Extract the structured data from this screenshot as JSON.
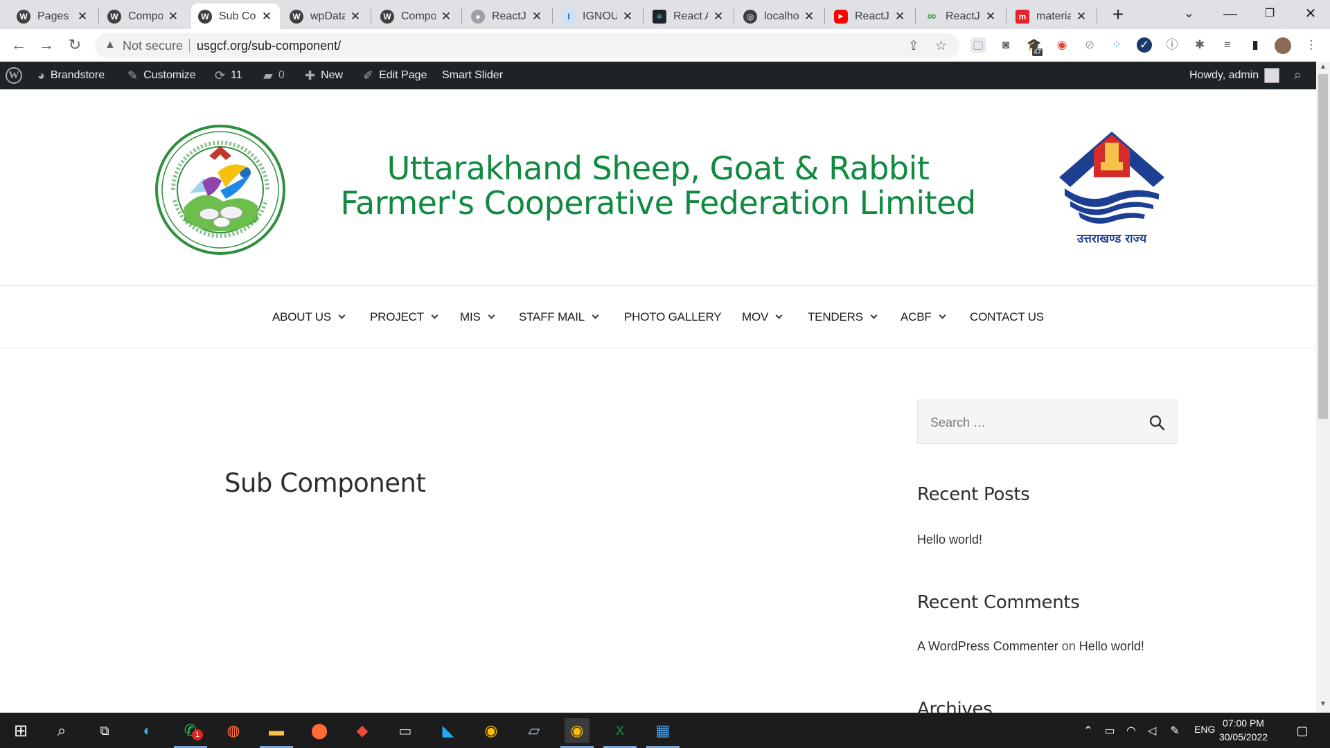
{
  "browser": {
    "tabs": [
      {
        "title": "Pages ‹",
        "icon": "wordpress-icon"
      },
      {
        "title": "Compo",
        "icon": "wordpress-icon"
      },
      {
        "title": "Sub Co",
        "icon": "wordpress-icon",
        "active": true
      },
      {
        "title": "wpData",
        "icon": "wordpress-icon"
      },
      {
        "title": "Compo",
        "icon": "wordpress-icon"
      },
      {
        "title": "ReactJs",
        "icon": "github-icon"
      },
      {
        "title": "IGNOU",
        "icon": "ignou-icon"
      },
      {
        "title": "React A",
        "icon": "react-icon"
      },
      {
        "title": "localho",
        "icon": "globe-icon"
      },
      {
        "title": "ReactJS",
        "icon": "youtube-icon"
      },
      {
        "title": "ReactJS",
        "icon": "infinity-icon"
      },
      {
        "title": "materia",
        "icon": "m-icon"
      }
    ],
    "new_tab": "+",
    "security_label": "Not secure",
    "url": "usgcf.org/sub-component/",
    "extension_badge": "47"
  },
  "adminbar": {
    "site_name": "Brandstore",
    "customize": "Customize",
    "updates_count": "11",
    "comments_count": "0",
    "new_label": "New",
    "edit_page": "Edit Page",
    "smart_slider": "Smart Slider",
    "howdy": "Howdy, admin"
  },
  "site": {
    "title_line1": "Uttarakhand Sheep, Goat & Rabbit",
    "title_line2": "Farmer's Cooperative Federation Limited",
    "emblem_text": "उत्तराखण्ड राज्य",
    "nav": [
      {
        "label": "ABOUT US",
        "has_dropdown": true
      },
      {
        "label": "PROJECT",
        "has_dropdown": true
      },
      {
        "label": "MIS",
        "has_dropdown": true
      },
      {
        "label": "STAFF MAIL",
        "has_dropdown": true
      },
      {
        "label": "PHOTO GALLERY",
        "has_dropdown": false
      },
      {
        "label": "MOV",
        "has_dropdown": true
      },
      {
        "label": "TENDERS",
        "has_dropdown": true
      },
      {
        "label": "ACBF",
        "has_dropdown": true
      },
      {
        "label": "CONTACT US",
        "has_dropdown": false
      }
    ],
    "page_title": "Sub Component",
    "search_placeholder": "Search …",
    "recent_posts_title": "Recent Posts",
    "recent_posts": [
      "Hello world!"
    ],
    "recent_comments_title": "Recent Comments",
    "comment_author": "A WordPress Commenter",
    "comment_on": "on",
    "comment_post": "Hello world!",
    "archives_title": "Archives",
    "accent_color": "#0f8a3f"
  },
  "taskbar": {
    "time": "07:00 PM",
    "date": "30/05/2022",
    "language": "ENG",
    "whatsapp_badge": "1"
  }
}
